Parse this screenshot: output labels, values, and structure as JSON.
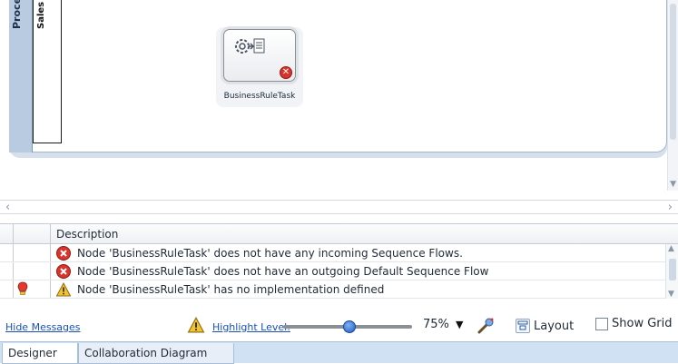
{
  "canvas": {
    "pool_name": "Process",
    "lane_name": "Sales",
    "task": {
      "label": "BusinessRuleTask",
      "icon": "business-rule-gear-icon",
      "status_icon": "error-icon"
    }
  },
  "messages": {
    "header": {
      "description": "Description"
    },
    "rows": [
      {
        "severity": "error",
        "marker": "",
        "text": "Node 'BusinessRuleTask' does not have any incoming Sequence Flows."
      },
      {
        "severity": "error",
        "marker": "",
        "text": "Node 'BusinessRuleTask' does not have an outgoing Default Sequence Flow"
      },
      {
        "severity": "warning",
        "marker": "bulb-icon",
        "text": "Node 'BusinessRuleTask' has no implementation defined"
      }
    ]
  },
  "toolbar": {
    "hide_messages": "Hide Messages",
    "highlight_level": "Highlight Level:",
    "zoom": "75%",
    "layout": "Layout",
    "show_grid": "Show Grid"
  },
  "tabs": [
    {
      "label": "Designer",
      "active": true
    },
    {
      "label": "Collaboration Diagram",
      "active": false
    }
  ],
  "colors": {
    "accent_link": "#1a4fb5",
    "error": "#d9342b",
    "warning": "#f2c230",
    "tab_bar": "#cfe1f2"
  }
}
